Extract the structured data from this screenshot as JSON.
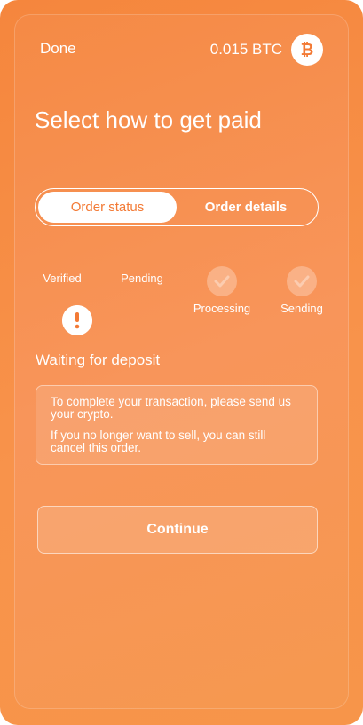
{
  "header": {
    "done_label": "Done",
    "balance": "0.015 BTC",
    "currency_icon": "bitcoin-icon"
  },
  "page": {
    "title": "Select how to get paid"
  },
  "tabs": [
    {
      "label": "Order status",
      "active": true
    },
    {
      "label": "Order details",
      "active": false
    }
  ],
  "steps": [
    {
      "label": "Verified",
      "state": "complete",
      "icon": "check-icon"
    },
    {
      "label": "Pending",
      "state": "current",
      "icon": "exclamation-icon"
    },
    {
      "label": "Processing",
      "state": "upcoming",
      "icon": "check-icon"
    },
    {
      "label": "Sending",
      "state": "upcoming",
      "icon": "check-icon"
    }
  ],
  "deposit": {
    "title": "Waiting for deposit",
    "message": "To complete your transaction, please send us your crypto.",
    "cancel_prefix": "If you no longer want to sell, you can still",
    "cancel_link": "cancel this order."
  },
  "actions": {
    "continue_label": "Continue"
  },
  "colors": {
    "accent": "#f37a35",
    "background": "#f78e47",
    "text": "#ffffff"
  }
}
